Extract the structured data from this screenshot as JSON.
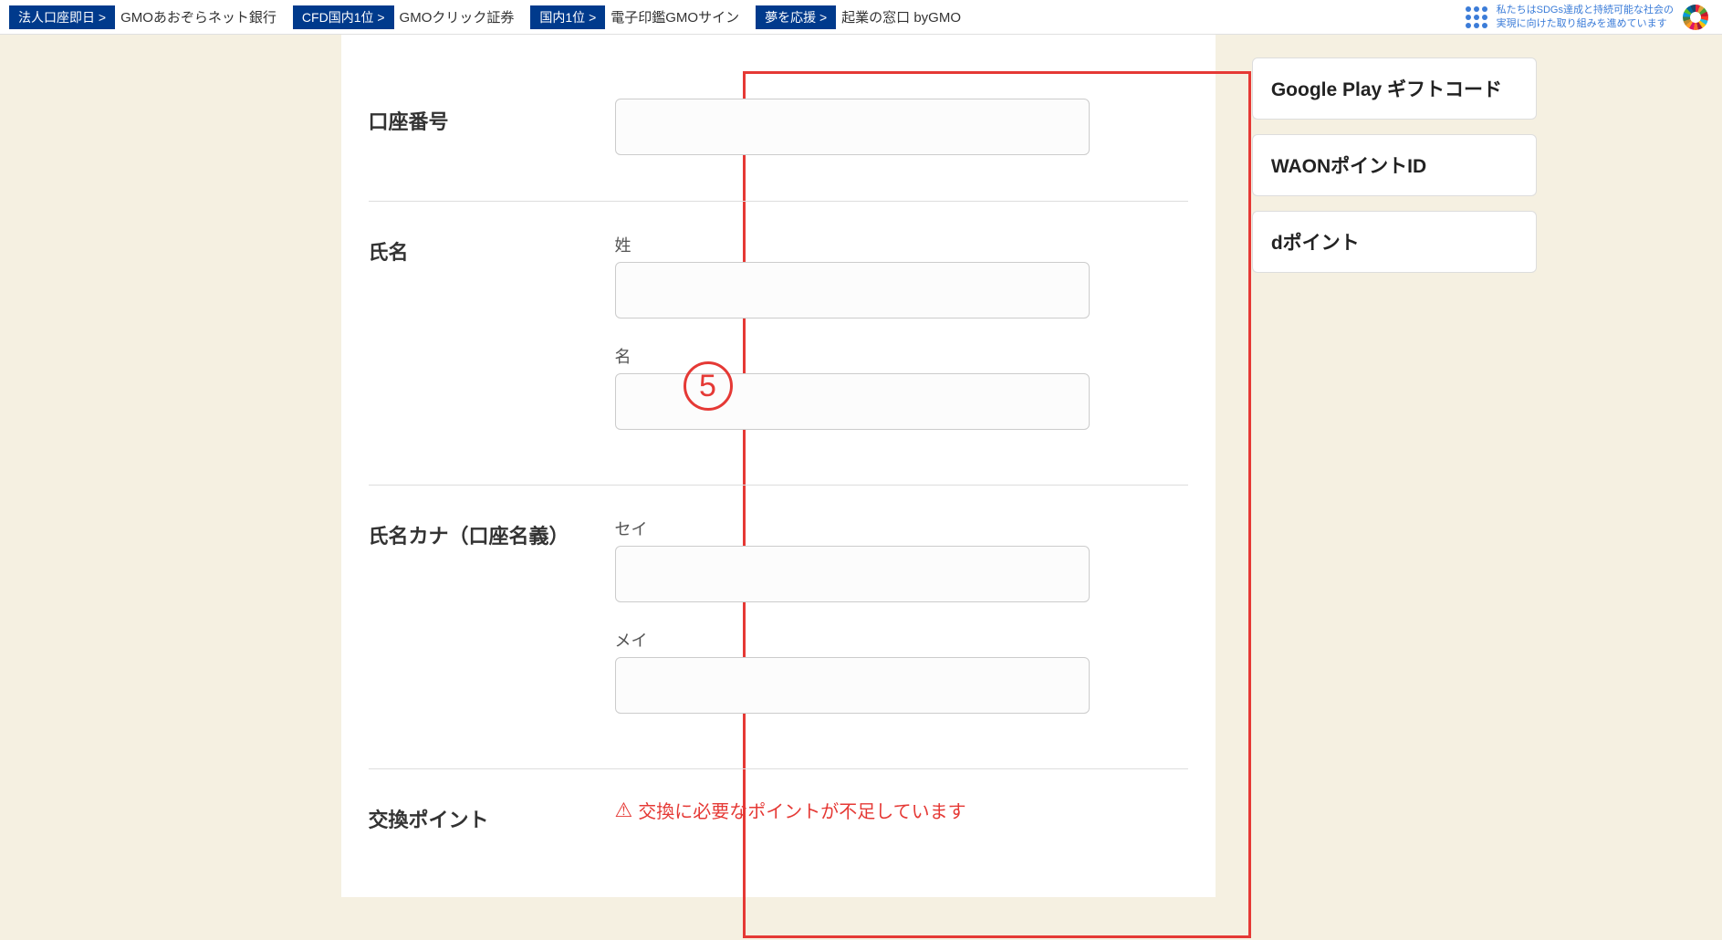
{
  "topbar": {
    "items": [
      {
        "tag": "法人口座即日 >",
        "text": "GMOあおぞらネット銀行"
      },
      {
        "tag": "CFD国内1位 >",
        "text": "GMOクリック証券"
      },
      {
        "tag": "国内1位 >",
        "text": "電子印鑑GMOサイン"
      },
      {
        "tag": "夢を応援 >",
        "text": "起業の窓口 byGMO"
      }
    ],
    "sdgs_line1": "私たちはSDGs達成と持続可能な社会の",
    "sdgs_line2": "実現に向けた取り組みを進めています"
  },
  "form": {
    "account_number": {
      "label": "口座番号"
    },
    "name": {
      "label": "氏名",
      "last_label": "姓",
      "first_label": "名"
    },
    "name_kana": {
      "label": "氏名カナ（口座名義）",
      "sei_label": "セイ",
      "mei_label": "メイ"
    },
    "exchange_points": {
      "label": "交換ポイント",
      "error": "交換に必要なポイントが不足しています"
    },
    "step_marker": "5"
  },
  "sidebar": {
    "cards": [
      {
        "label": "Google Play ギフトコード"
      },
      {
        "label": "WAONポイントID"
      },
      {
        "label": "dポイント"
      }
    ]
  }
}
